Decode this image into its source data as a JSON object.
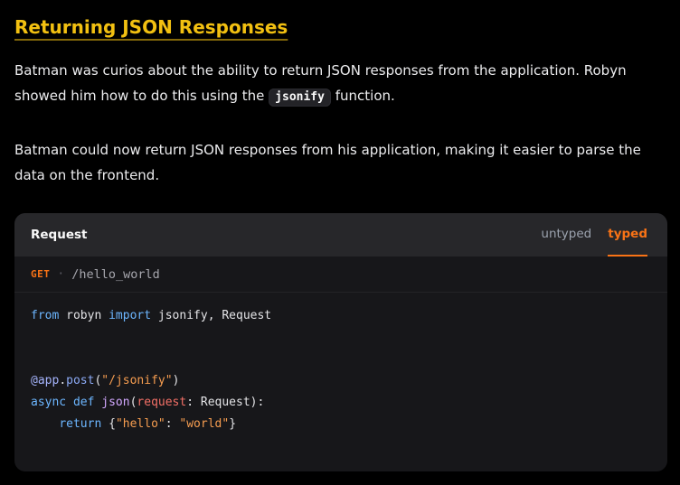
{
  "page": {
    "background": "#000000"
  },
  "heading": {
    "text": "Returning JSON Responses",
    "color": "#f2c011"
  },
  "paragraphs": {
    "p1_before": "Batman was curios about the ability to return JSON responses from the application. Robyn showed him how to do this using the ",
    "p1_inline_code": "jsonify",
    "p1_after": " function.",
    "p2": "Batman could now return JSON responses from his application, making it easier to parse the data on the frontend."
  },
  "request_card": {
    "title": "Request",
    "tabs": [
      {
        "label": "untyped",
        "active": false
      },
      {
        "label": "typed",
        "active": true
      }
    ],
    "accent_orange": "#f97316",
    "route": {
      "method": "GET",
      "separator": "·",
      "path": "/hello_world"
    },
    "code": {
      "language": "python",
      "plain_text": "from robyn import jsonify, Request\n\n\n@app.post(\"/jsonify\")\nasync def json(request: Request):\n    return {\"hello\": \"world\"}",
      "palette": {
        "kw": "#6cb6ff",
        "plain": "#e4e4e7",
        "deco": "#a5b4fc",
        "meth": "#8caaf5",
        "fn": "#d2a8ff",
        "param": "#f47067",
        "str": "#f69d50"
      },
      "lines": [
        [
          {
            "t": "from",
            "c": "kw"
          },
          {
            "t": " robyn ",
            "c": "plain"
          },
          {
            "t": "import",
            "c": "kw"
          },
          {
            "t": " jsonify, Request",
            "c": "plain"
          }
        ],
        [],
        [],
        [
          {
            "t": "@app",
            "c": "deco"
          },
          {
            "t": ".",
            "c": "plain"
          },
          {
            "t": "post",
            "c": "meth"
          },
          {
            "t": "(",
            "c": "plain"
          },
          {
            "t": "\"/jsonify\"",
            "c": "str"
          },
          {
            "t": ")",
            "c": "plain"
          }
        ],
        [
          {
            "t": "async",
            "c": "kw"
          },
          {
            "t": " ",
            "c": "plain"
          },
          {
            "t": "def",
            "c": "kw"
          },
          {
            "t": " ",
            "c": "plain"
          },
          {
            "t": "json",
            "c": "fn"
          },
          {
            "t": "(",
            "c": "plain"
          },
          {
            "t": "request",
            "c": "param"
          },
          {
            "t": ": Request):",
            "c": "plain"
          }
        ],
        [
          {
            "t": "    ",
            "c": "plain"
          },
          {
            "t": "return",
            "c": "kw"
          },
          {
            "t": " {",
            "c": "plain"
          },
          {
            "t": "\"hello\"",
            "c": "str"
          },
          {
            "t": ": ",
            "c": "plain"
          },
          {
            "t": "\"world\"",
            "c": "str"
          },
          {
            "t": "}",
            "c": "plain"
          }
        ]
      ]
    }
  }
}
